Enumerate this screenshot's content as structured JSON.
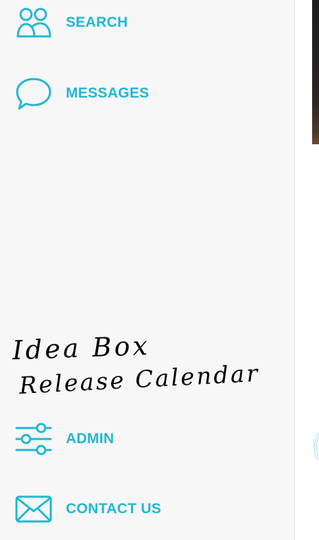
{
  "colors": {
    "accent": "#1fb8d2",
    "sidebar_bg": "#f7f7f7",
    "handwriting": "#000000"
  },
  "sidebar": {
    "items": [
      {
        "label": "SEARCH",
        "icon": "people-icon"
      },
      {
        "label": "MESSAGES",
        "icon": "speech-bubble-icon"
      },
      {
        "label": "ADMIN",
        "icon": "sliders-icon"
      },
      {
        "label": "CONTACT US",
        "icon": "envelope-icon"
      }
    ],
    "handwritten_notes": [
      "Idea Box",
      "Release Calendar"
    ]
  }
}
